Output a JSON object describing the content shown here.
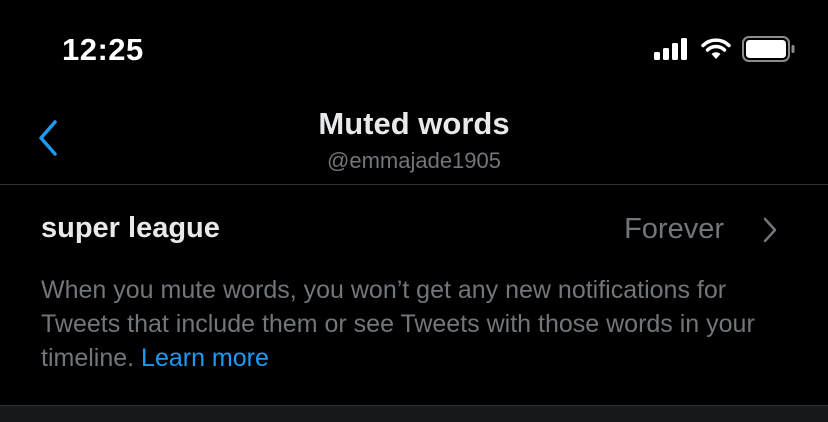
{
  "status_bar": {
    "time": "12:25",
    "icons": [
      "cellular-signal-icon",
      "wifi-icon",
      "battery-icon"
    ]
  },
  "header": {
    "title": "Muted words",
    "subtitle": "@emmajade1905",
    "back_icon": "chevron-left-icon"
  },
  "muted_word": {
    "word": "super league",
    "duration": "Forever",
    "chevron_icon": "chevron-right-icon"
  },
  "description": {
    "text": "When you mute words, you won’t get any new notifications for Tweets that include them or see Tweets with those words in your timeline.",
    "link_label": "Learn more"
  },
  "colors": {
    "background": "#000000",
    "primary_text": "#e7e9ea",
    "secondary_text": "#71767b",
    "accent": "#1d9bf0",
    "divider": "#2f3336"
  }
}
